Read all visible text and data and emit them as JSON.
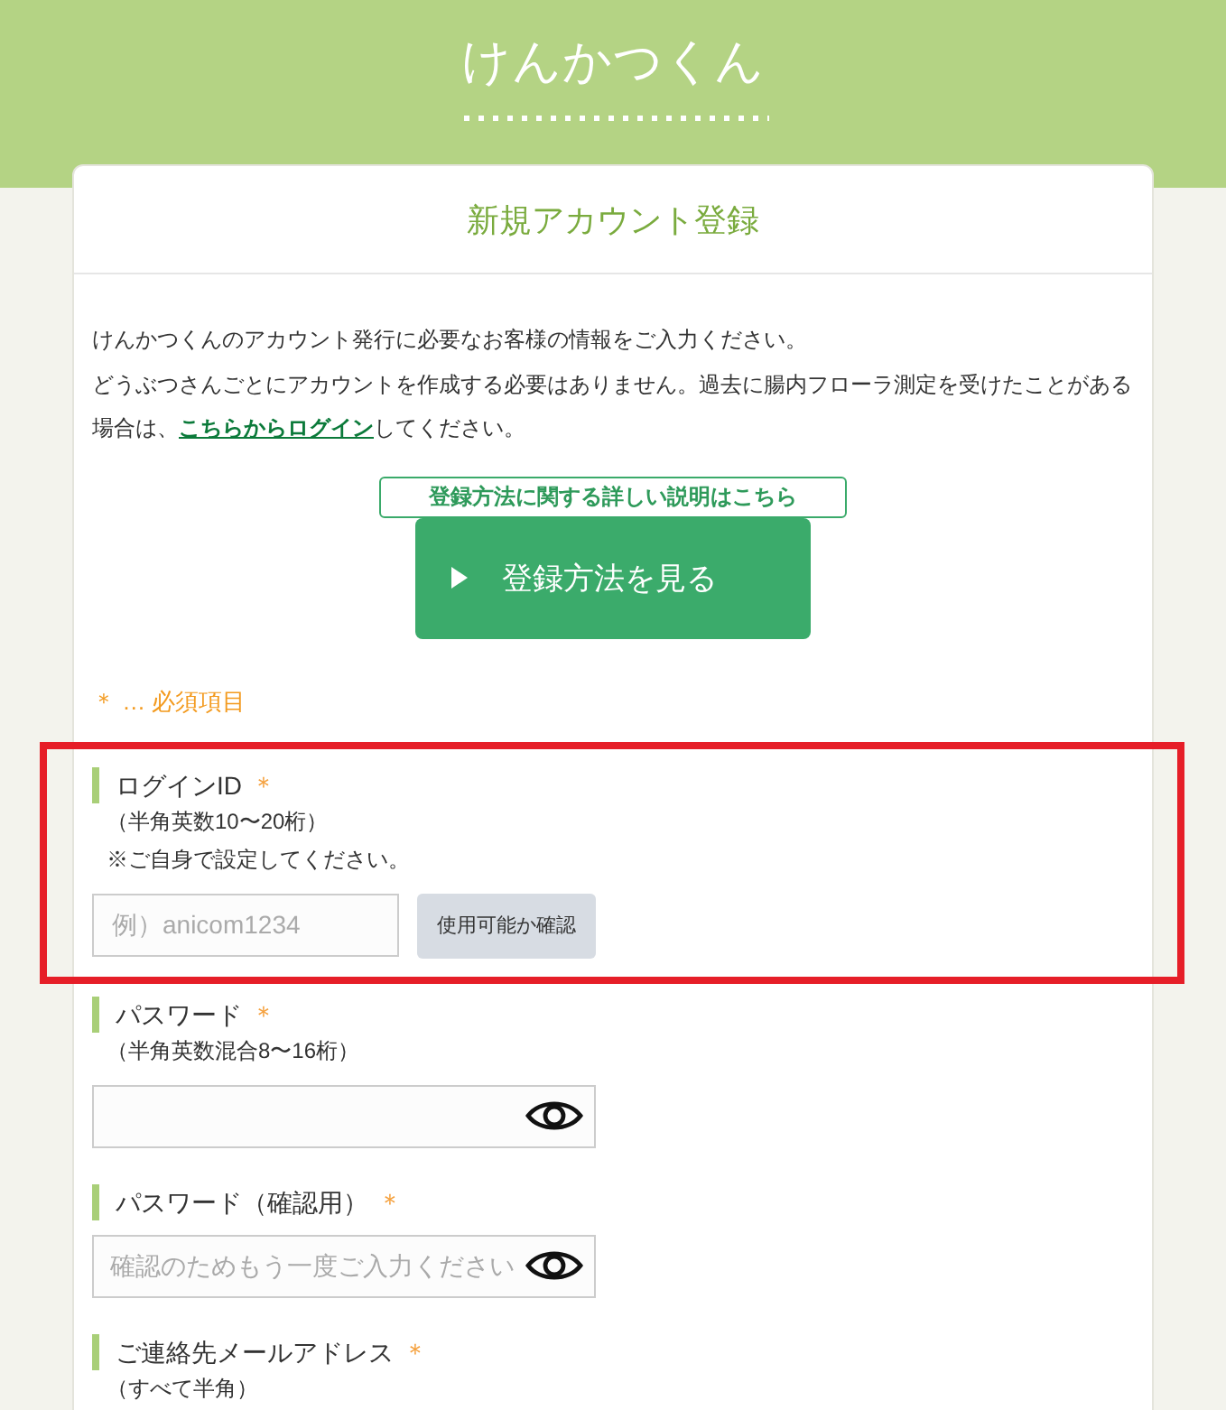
{
  "header": {
    "logo": "けんかつくん"
  },
  "card": {
    "title": "新規アカウント登録"
  },
  "intro": [
    {
      "text": "けんかつくんのアカウント発行に必要なお客様の情報をご入力ください。"
    },
    {
      "text": "どうぶつさんごとにアカウントを作成する必要はありません。過去に腸内フローラ測定を受けたことがある場合は、",
      "link": "こちらからログイン",
      "after": "してください。"
    }
  ],
  "guide": {
    "link": "登録方法に関する詳しい説明はこちら",
    "button": "登録方法を見る"
  },
  "required_note": "＊ … 必須項目",
  "fields": [
    {
      "kind": "check",
      "label": "ログインID",
      "mark": "＊",
      "hints": [
        "（半角英数10〜20桁）",
        "※ご自身で設定してください。"
      ],
      "placeholder": "例）anicom1234",
      "button": "使用可能か確認",
      "highlighted": true
    },
    {
      "kind": "password",
      "label": "パスワード",
      "mark": "＊",
      "hints": [
        "（半角英数混合8〜16桁）"
      ],
      "highlighted": false
    },
    {
      "kind": "password",
      "label": "パスワード（確認用）",
      "mark": "＊",
      "placeholder": "確認のためもう一度ご入力ください",
      "highlighted": false
    },
    {
      "label": "ご連絡先メールアドレス",
      "mark": "＊",
      "hints": [
        "（すべて半角）"
      ],
      "highlighted": false
    }
  ]
}
